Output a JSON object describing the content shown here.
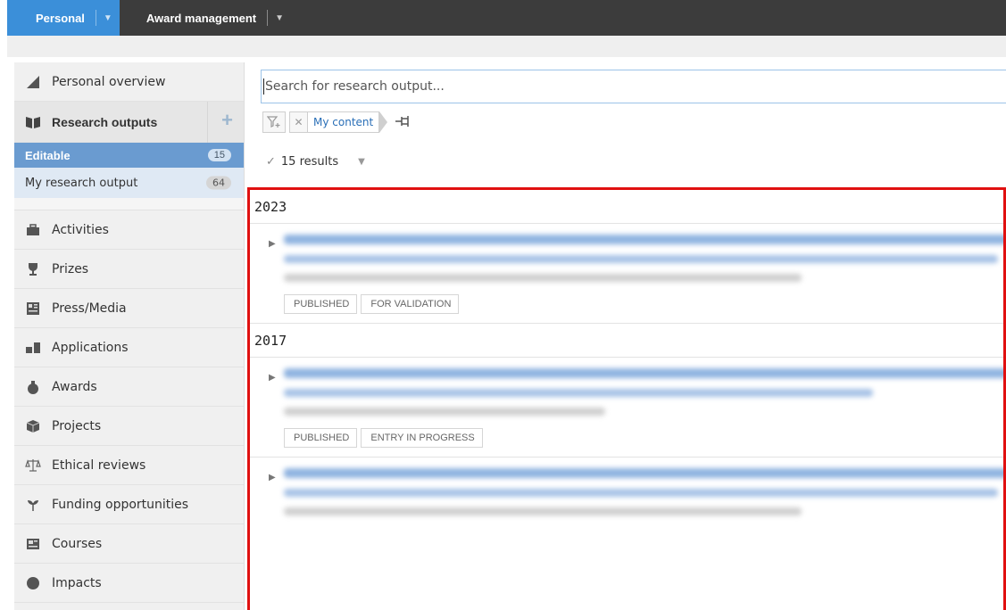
{
  "topnav": {
    "personal_label": "Personal",
    "award_label": "Award management"
  },
  "sidebar": {
    "personal_overview": "Personal overview",
    "research_outputs": "Research outputs",
    "editable_label": "Editable",
    "editable_count": "15",
    "my_output_label": "My research output",
    "my_output_count": "64",
    "items": [
      {
        "label": "Activities",
        "icon": "briefcase-icon"
      },
      {
        "label": "Prizes",
        "icon": "trophy-icon"
      },
      {
        "label": "Press/Media",
        "icon": "newspaper-icon"
      },
      {
        "label": "Applications",
        "icon": "applications-icon"
      },
      {
        "label": "Awards",
        "icon": "money-bag-icon"
      },
      {
        "label": "Projects",
        "icon": "cube-icon"
      },
      {
        "label": "Ethical reviews",
        "icon": "scales-icon"
      },
      {
        "label": "Funding opportunities",
        "icon": "sprout-icon"
      },
      {
        "label": "Courses",
        "icon": "courses-icon"
      },
      {
        "label": "Impacts",
        "icon": "impacts-icon"
      }
    ]
  },
  "search": {
    "placeholder": "Search for research output..."
  },
  "filters": {
    "chip_label": "My content"
  },
  "results": {
    "count_label": "15 results"
  },
  "groups": [
    {
      "year": "2023",
      "tags": [
        "PUBLISHED",
        "FOR VALIDATION"
      ]
    },
    {
      "year": "2017",
      "tags": [
        "PUBLISHED",
        "ENTRY IN PROGRESS"
      ]
    }
  ],
  "colors": {
    "accent": "#3b8fd9",
    "highlight_border": "#e01010",
    "topbar": "#3c3c3c"
  }
}
